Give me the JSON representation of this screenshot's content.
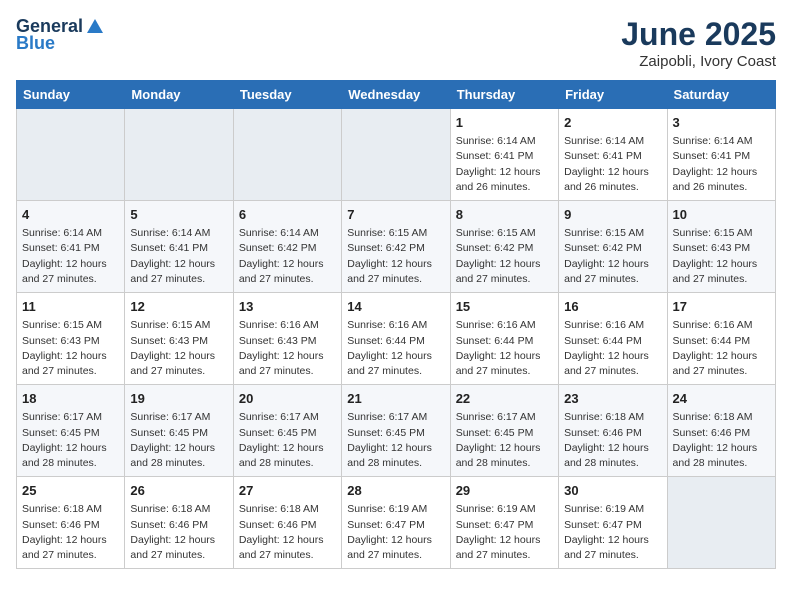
{
  "header": {
    "logo_general": "General",
    "logo_blue": "Blue",
    "title": "June 2025",
    "subtitle": "Zaipobli, Ivory Coast"
  },
  "calendar": {
    "weekdays": [
      "Sunday",
      "Monday",
      "Tuesday",
      "Wednesday",
      "Thursday",
      "Friday",
      "Saturday"
    ],
    "weeks": [
      [
        null,
        null,
        null,
        null,
        {
          "day": 1,
          "sunrise": "6:14 AM",
          "sunset": "6:41 PM",
          "daylight": "12 hours and 26 minutes."
        },
        {
          "day": 2,
          "sunrise": "6:14 AM",
          "sunset": "6:41 PM",
          "daylight": "12 hours and 26 minutes."
        },
        {
          "day": 3,
          "sunrise": "6:14 AM",
          "sunset": "6:41 PM",
          "daylight": "12 hours and 26 minutes."
        },
        {
          "day": 4,
          "sunrise": "6:14 AM",
          "sunset": "6:41 PM",
          "daylight": "12 hours and 27 minutes."
        },
        {
          "day": 5,
          "sunrise": "6:14 AM",
          "sunset": "6:41 PM",
          "daylight": "12 hours and 27 minutes."
        },
        {
          "day": 6,
          "sunrise": "6:14 AM",
          "sunset": "6:42 PM",
          "daylight": "12 hours and 27 minutes."
        },
        {
          "day": 7,
          "sunrise": "6:15 AM",
          "sunset": "6:42 PM",
          "daylight": "12 hours and 27 minutes."
        }
      ],
      [
        {
          "day": 8,
          "sunrise": "6:15 AM",
          "sunset": "6:42 PM",
          "daylight": "12 hours and 27 minutes."
        },
        {
          "day": 9,
          "sunrise": "6:15 AM",
          "sunset": "6:42 PM",
          "daylight": "12 hours and 27 minutes."
        },
        {
          "day": 10,
          "sunrise": "6:15 AM",
          "sunset": "6:43 PM",
          "daylight": "12 hours and 27 minutes."
        },
        {
          "day": 11,
          "sunrise": "6:15 AM",
          "sunset": "6:43 PM",
          "daylight": "12 hours and 27 minutes."
        },
        {
          "day": 12,
          "sunrise": "6:15 AM",
          "sunset": "6:43 PM",
          "daylight": "12 hours and 27 minutes."
        },
        {
          "day": 13,
          "sunrise": "6:16 AM",
          "sunset": "6:43 PM",
          "daylight": "12 hours and 27 minutes."
        },
        {
          "day": 14,
          "sunrise": "6:16 AM",
          "sunset": "6:44 PM",
          "daylight": "12 hours and 27 minutes."
        }
      ],
      [
        {
          "day": 15,
          "sunrise": "6:16 AM",
          "sunset": "6:44 PM",
          "daylight": "12 hours and 27 minutes."
        },
        {
          "day": 16,
          "sunrise": "6:16 AM",
          "sunset": "6:44 PM",
          "daylight": "12 hours and 27 minutes."
        },
        {
          "day": 17,
          "sunrise": "6:16 AM",
          "sunset": "6:44 PM",
          "daylight": "12 hours and 27 minutes."
        },
        {
          "day": 18,
          "sunrise": "6:17 AM",
          "sunset": "6:45 PM",
          "daylight": "12 hours and 28 minutes."
        },
        {
          "day": 19,
          "sunrise": "6:17 AM",
          "sunset": "6:45 PM",
          "daylight": "12 hours and 28 minutes."
        },
        {
          "day": 20,
          "sunrise": "6:17 AM",
          "sunset": "6:45 PM",
          "daylight": "12 hours and 28 minutes."
        },
        {
          "day": 21,
          "sunrise": "6:17 AM",
          "sunset": "6:45 PM",
          "daylight": "12 hours and 28 minutes."
        }
      ],
      [
        {
          "day": 22,
          "sunrise": "6:17 AM",
          "sunset": "6:45 PM",
          "daylight": "12 hours and 28 minutes."
        },
        {
          "day": 23,
          "sunrise": "6:18 AM",
          "sunset": "6:46 PM",
          "daylight": "12 hours and 28 minutes."
        },
        {
          "day": 24,
          "sunrise": "6:18 AM",
          "sunset": "6:46 PM",
          "daylight": "12 hours and 28 minutes."
        },
        {
          "day": 25,
          "sunrise": "6:18 AM",
          "sunset": "6:46 PM",
          "daylight": "12 hours and 27 minutes."
        },
        {
          "day": 26,
          "sunrise": "6:18 AM",
          "sunset": "6:46 PM",
          "daylight": "12 hours and 27 minutes."
        },
        {
          "day": 27,
          "sunrise": "6:18 AM",
          "sunset": "6:46 PM",
          "daylight": "12 hours and 27 minutes."
        },
        {
          "day": 28,
          "sunrise": "6:19 AM",
          "sunset": "6:47 PM",
          "daylight": "12 hours and 27 minutes."
        }
      ],
      [
        {
          "day": 29,
          "sunrise": "6:19 AM",
          "sunset": "6:47 PM",
          "daylight": "12 hours and 27 minutes."
        },
        {
          "day": 30,
          "sunrise": "6:19 AM",
          "sunset": "6:47 PM",
          "daylight": "12 hours and 27 minutes."
        },
        null,
        null,
        null,
        null,
        null
      ]
    ]
  }
}
